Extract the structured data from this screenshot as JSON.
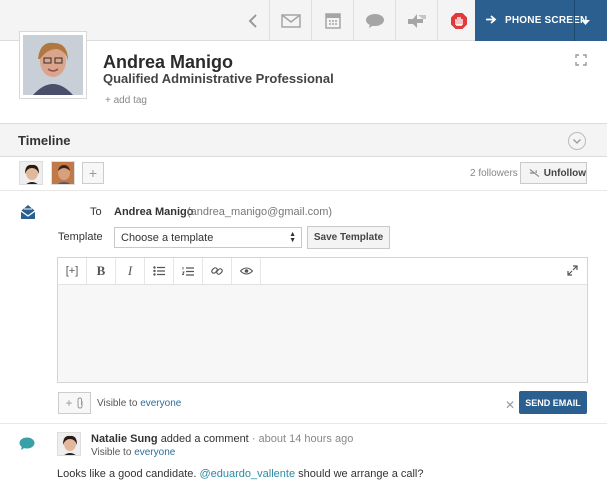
{
  "toolbar": {
    "icons": [
      "back-icon",
      "mail-icon",
      "calendar-icon",
      "comment-icon",
      "thumbs-icon",
      "stop-icon"
    ],
    "phone_screen_label": "PHONE SCREEN"
  },
  "profile": {
    "name": "Andrea Manigo",
    "title": "Qualified Administrative Professional",
    "add_tag": "+ add tag"
  },
  "timeline": {
    "title": "Timeline",
    "add_follower": "+",
    "followers_count": "2 followers",
    "unfollow_label": "Unfollow"
  },
  "composer": {
    "to_label": "To",
    "to_name": "Andrea Manigo",
    "to_email": "(andrea_manigo@gmail.com)",
    "template_label": "Template",
    "template_value": "Choose a template",
    "save_template_label": "Save Template",
    "editor_buttons": {
      "placeholder": "[+]",
      "bold": "B",
      "italic": "I"
    },
    "attach_label": "+",
    "visible_prefix": "Visible to",
    "visible_target": "everyone",
    "close_label": "✕",
    "send_label": "SEND EMAIL"
  },
  "comment": {
    "author": "Natalie Sung",
    "action": "added a comment",
    "time": "· about 14 hours ago",
    "visible_prefix": "Visible to",
    "visible_target": "everyone",
    "text_before": "Looks like a good candidate.",
    "mention": "@eduardo_vallente",
    "text_after": "should we arrange a call?"
  },
  "colors": {
    "accent": "#2a5f8f",
    "link": "#2b6d9b",
    "stop_red": "#e03b3b",
    "teal": "#3aa0a8"
  }
}
